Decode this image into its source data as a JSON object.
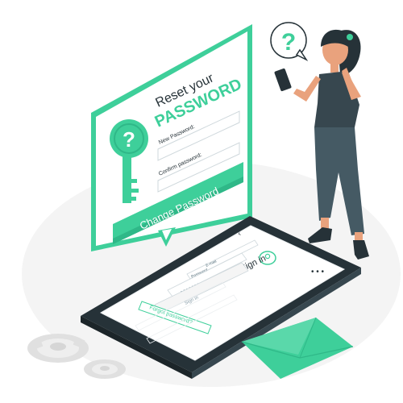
{
  "reset_card": {
    "title_line1": "Reset your",
    "title_line2": "PASSWORD",
    "new_password_label": "New Password:",
    "confirm_password_label": "Confirm password:",
    "change_button_label": "Change Password"
  },
  "phone_screen": {
    "title": "Sign in",
    "email_label": "E-mail",
    "password_label": "Password",
    "password_dots": "• • • • • • •",
    "sign_in_button_label": "Sign in",
    "forgot_link_label": "Forgot password?"
  },
  "thought_bubble": {
    "symbol": "?"
  },
  "key": {
    "symbol": "?"
  },
  "colors": {
    "accent": "#3ecf9a",
    "accent_dark": "#2fb888",
    "accent_light": "#e6f8f0",
    "ink": "#263238",
    "grey_bg": "#f2f2f2",
    "skin": "#e9a27d",
    "pants": "#455a64",
    "top": "#37474f"
  }
}
